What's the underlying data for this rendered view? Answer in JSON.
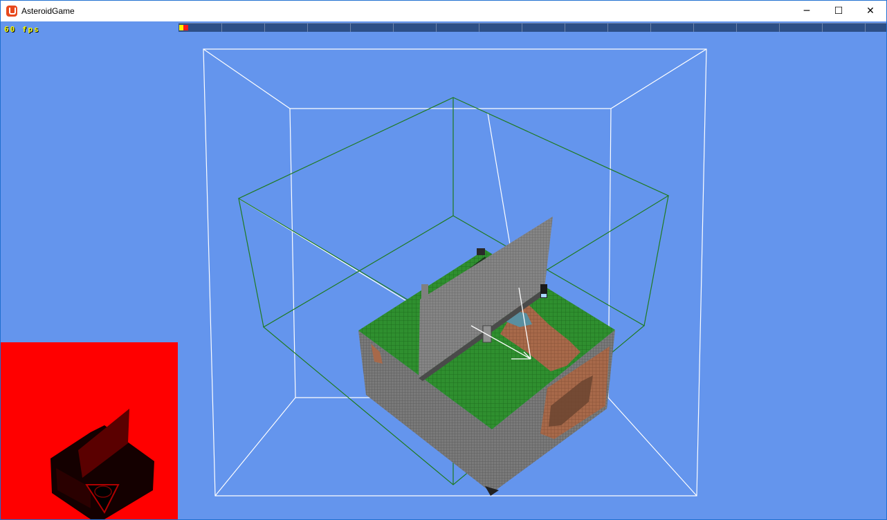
{
  "window": {
    "title": "AsteroidGame",
    "controls": {
      "minimize": "─",
      "maximize": "☐",
      "close": "✕"
    }
  },
  "hud": {
    "fps_label": "60 fps",
    "perf_bar_segments": 16
  },
  "colors": {
    "background": "#6495ed",
    "minimap_background": "#ff0000",
    "grass": "#2f8f2f",
    "stone": "#7a7a7a",
    "dirt": "#a7694a",
    "wireframe_outer": "#ffffff",
    "wireframe_inner": "#1f7a1f",
    "perf_bar": "#2d4f86"
  },
  "icons": {
    "app": "monogame-logo-icon",
    "minimize": "minimize-icon",
    "maximize": "maximize-icon",
    "close": "close-icon"
  }
}
